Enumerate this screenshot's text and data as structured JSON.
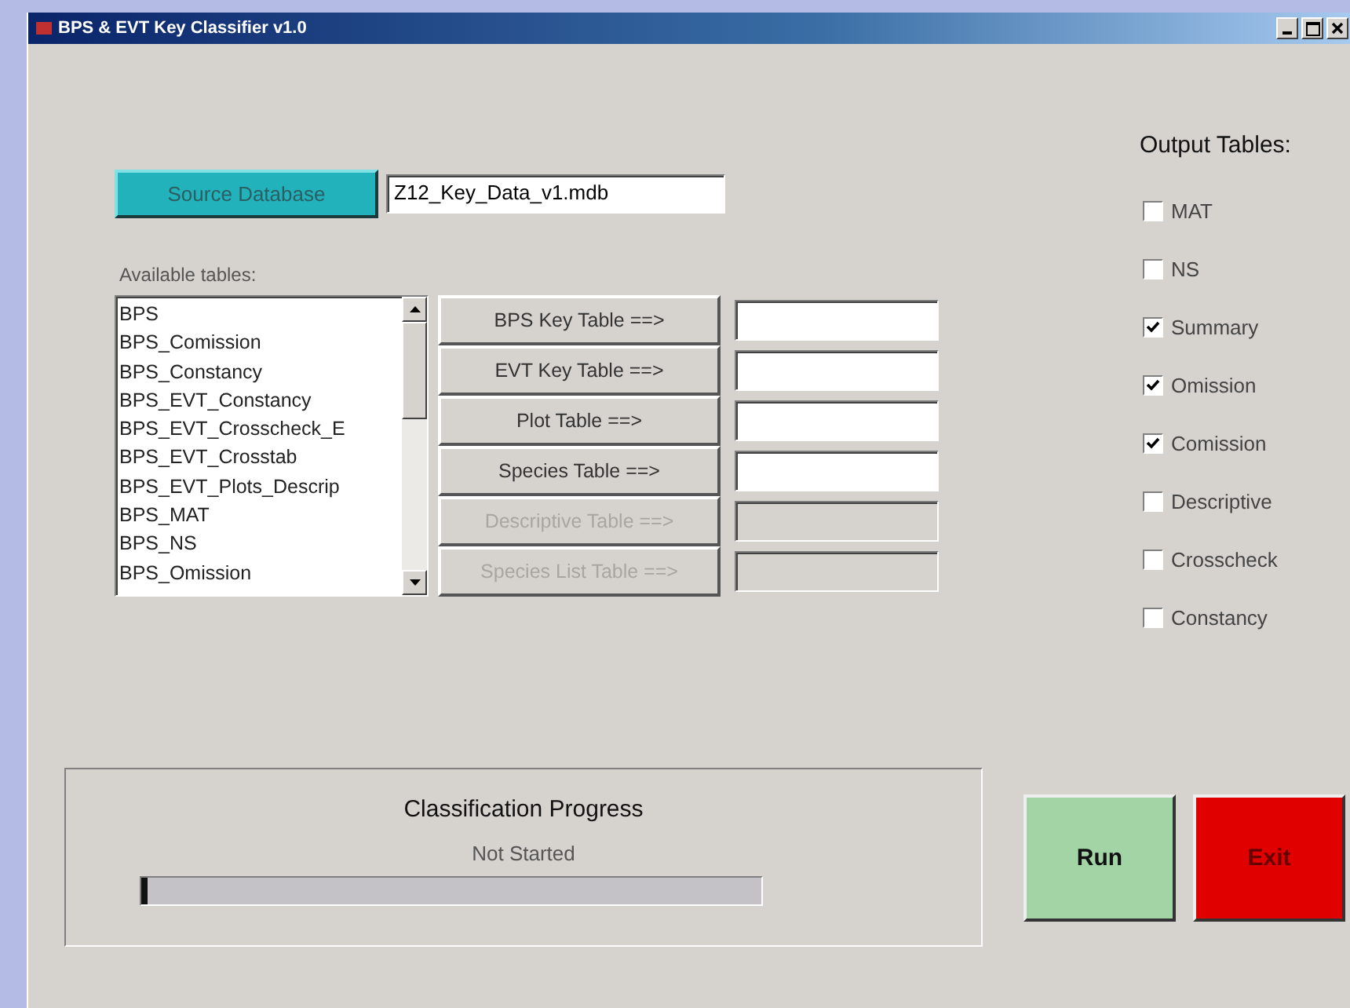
{
  "window": {
    "title": "BPS & EVT Key Classifier v1.0"
  },
  "source": {
    "button": "Source Database",
    "value": "Z12_Key_Data_v1.mdb"
  },
  "available": {
    "label": "Available tables:",
    "items": [
      {
        "label": "BPS",
        "selected": false
      },
      {
        "label": "BPS_Comission",
        "selected": false
      },
      {
        "label": "BPS_Constancy",
        "selected": false
      },
      {
        "label": "BPS_EVT_Constancy",
        "selected": false
      },
      {
        "label": "BPS_EVT_Crosscheck_E",
        "selected": false
      },
      {
        "label": "BPS_EVT_Crosstab",
        "selected": false
      },
      {
        "label": "BPS_EVT_Plots_Descrip",
        "selected": false
      },
      {
        "label": "BPS_MAT",
        "selected": false
      },
      {
        "label": "BPS_NS",
        "selected": false
      },
      {
        "label": "BPS_Omission",
        "selected": false
      }
    ]
  },
  "table_buttons": [
    {
      "label": "BPS Key Table ==>",
      "disabled": false
    },
    {
      "label": "EVT Key Table ==>",
      "disabled": false
    },
    {
      "label": "Plot Table ==>",
      "disabled": false
    },
    {
      "label": "Species Table ==>",
      "disabled": false
    },
    {
      "label": "Descriptive Table ==>",
      "disabled": true
    },
    {
      "label": "Species List Table ==>",
      "disabled": true
    }
  ],
  "output_tables": {
    "label": "Output Tables:",
    "items": [
      {
        "label": "MAT",
        "checked": false
      },
      {
        "label": "NS",
        "checked": false
      },
      {
        "label": "Summary",
        "checked": true
      },
      {
        "label": "Omission",
        "checked": true
      },
      {
        "label": "Comission",
        "checked": true
      },
      {
        "label": "Descriptive",
        "checked": false
      },
      {
        "label": "Crosscheck",
        "checked": false
      },
      {
        "label": "Constancy",
        "checked": false
      }
    ]
  },
  "progress": {
    "title": "Classification Progress",
    "status": "Not Started",
    "level": 0.01
  },
  "buttons": [
    {
      "label": "Run",
      "kind": "run"
    },
    {
      "label": "Exit",
      "kind": "exit"
    }
  ]
}
